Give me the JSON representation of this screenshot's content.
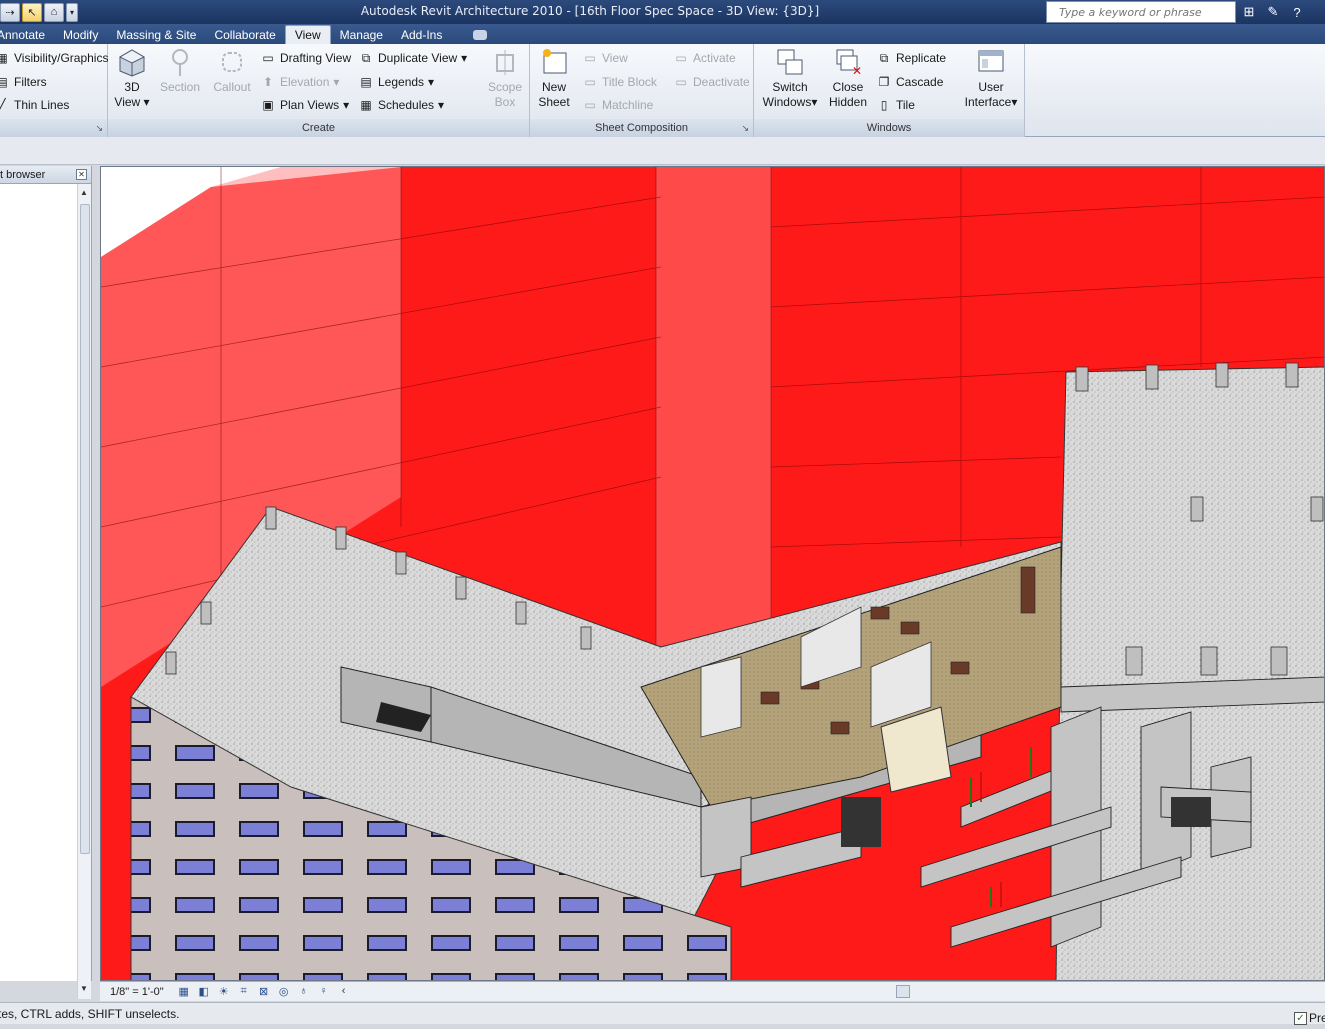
{
  "window": {
    "title": "Autodesk Revit Architecture 2010 - [16th Floor Spec Space - 3D View: {3D}]"
  },
  "search": {
    "placeholder": "Type a keyword or phrase"
  },
  "tabs": [
    "Annotate",
    "Modify",
    "Massing & Site",
    "Collaborate",
    "View",
    "Manage",
    "Add-Ins"
  ],
  "active_tab": "View",
  "ribbon": {
    "graphics": {
      "visibility_graphics": "Visibility/Graphics",
      "filters": "Filters",
      "thin_lines": "Thin Lines"
    },
    "create": {
      "title": "Create",
      "view_3d_line1": "3D",
      "view_3d_line2": "View",
      "section": "Section",
      "callout": "Callout",
      "drafting_view": "Drafting View",
      "elevation": "Elevation",
      "plan_views": "Plan Views",
      "duplicate_view": "Duplicate View",
      "legends": "Legends",
      "schedules": "Schedules",
      "scope_box_line1": "Scope",
      "scope_box_line2": "Box"
    },
    "sheet_composition": {
      "title": "Sheet Composition",
      "new_sheet_line1": "New",
      "new_sheet_line2": "Sheet",
      "view": "View",
      "title_block": "Title Block",
      "matchline": "Matchline",
      "activate": "Activate",
      "deactivate": "Deactivate"
    },
    "windows": {
      "title": "Windows",
      "switch_windows_line1": "Switch",
      "switch_windows_line2": "Windows",
      "close_hidden_line1": "Close",
      "close_hidden_line2": "Hidden",
      "replicate": "Replicate",
      "cascade": "Cascade",
      "tile": "Tile",
      "user_interface_line1": "User",
      "user_interface_line2": "Interface"
    }
  },
  "project_browser": {
    "title": "t browser"
  },
  "view_control": {
    "scale": "1/8\" = 1'-0\""
  },
  "status": {
    "text": "tes, CTRL adds, SHIFT unselects.",
    "press_drag_label": "Pre"
  },
  "colors": {
    "mass_red": "#ff1a1a",
    "floor_gray": "#d9d9d9",
    "title_bar": "#1b3461"
  }
}
